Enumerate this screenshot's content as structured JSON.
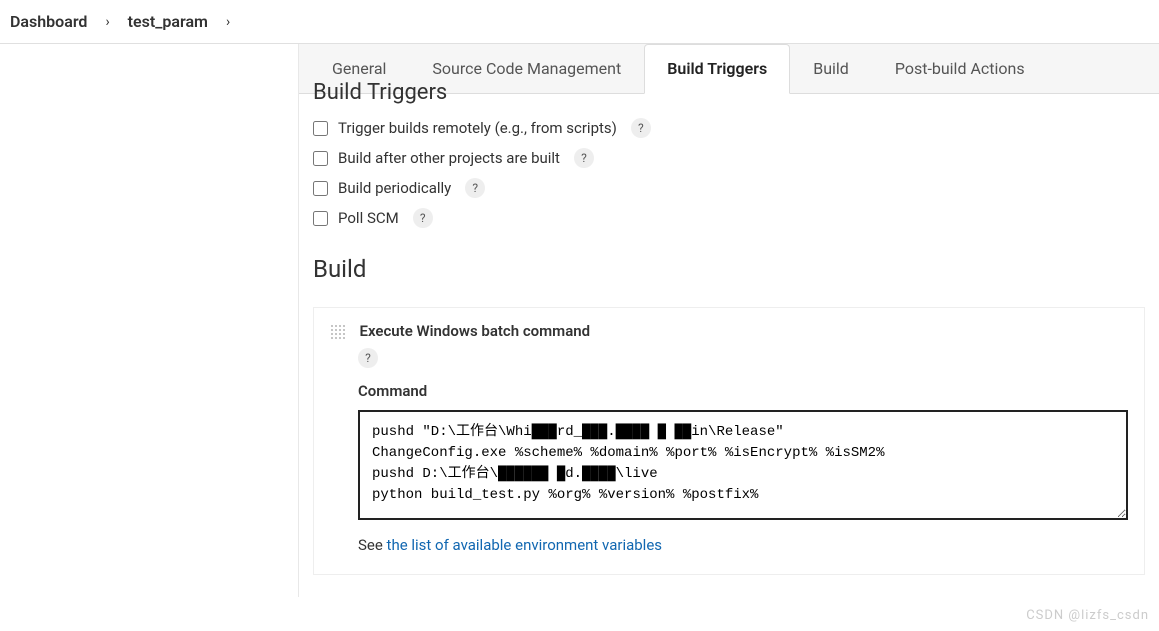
{
  "breadcrumb": {
    "items": [
      "Dashboard",
      "test_param"
    ]
  },
  "tabs": [
    {
      "label": "General",
      "active": false
    },
    {
      "label": "Source Code Management",
      "active": false
    },
    {
      "label": "Build Triggers",
      "active": true
    },
    {
      "label": "Build",
      "active": false
    },
    {
      "label": "Post-build Actions",
      "active": false
    }
  ],
  "triggers": {
    "heading": "Build Triggers",
    "items": [
      {
        "label": "Trigger builds remotely (e.g., from scripts)",
        "checked": false
      },
      {
        "label": "Build after other projects are built",
        "checked": false
      },
      {
        "label": "Build periodically",
        "checked": false
      },
      {
        "label": "Poll SCM",
        "checked": false
      }
    ]
  },
  "build": {
    "heading": "Build",
    "step_title": "Execute Windows batch command",
    "command_label": "Command",
    "command_value": "pushd \"D:\\工作台\\Whi███rd_███.████ █ ██in\\Release\"\nChangeConfig.exe %scheme% %domain% %port% %isEncrypt% %isSM2%\npushd D:\\工作台\\██████ █d.████\\live\npython build_test.py %org% %version% %postfix%",
    "see_prefix": "See ",
    "see_link": "the list of available environment variables"
  },
  "help_glyph": "?",
  "chevron": "›",
  "watermark": "CSDN @lizfs_csdn"
}
